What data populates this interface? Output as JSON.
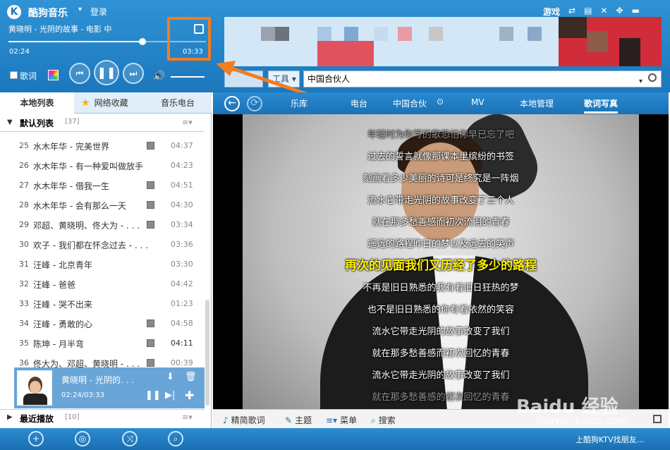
{
  "app": {
    "logo": "K",
    "title": "酷狗音乐",
    "login": "登录"
  },
  "player": {
    "track": "黄晓明 - 光阴的故事 - 电影 中",
    "elapsed": "02:24",
    "total": "03:33",
    "progress": 0.68,
    "lyric_toggle": "歌词",
    "prev": "⏮",
    "play": "❚❚",
    "next": "⏭",
    "volume_icon": "🔊"
  },
  "window": {
    "game": "游戏",
    "controls": [
      "⇄",
      "▤",
      "✕",
      "✥",
      "▬"
    ]
  },
  "toolbar": {
    "tools_label": "工具",
    "search_value": "中国合伙人",
    "caret": "▾"
  },
  "sidebar": {
    "tabs": {
      "local": "本地列表",
      "favorites": "网络收藏",
      "radio": "音乐电台"
    },
    "default_list": {
      "name": "默认列表",
      "count": "[37]",
      "menu": "≡▾"
    },
    "songs": [
      {
        "num": "25",
        "title": "水木年华 - 完美世界",
        "mv": true,
        "dur": "04:37",
        "dark": false
      },
      {
        "num": "26",
        "title": "水木年华 - 有一种爱叫做放手",
        "mv": false,
        "dur": "04:23",
        "dark": false
      },
      {
        "num": "27",
        "title": "水木年华 - 借我一生",
        "mv": true,
        "dur": "04:51",
        "dark": false
      },
      {
        "num": "28",
        "title": "水木年华 - 会有那么一天",
        "mv": true,
        "dur": "04:30",
        "dark": false
      },
      {
        "num": "29",
        "title": "邓超、黄晓明、佟大为 - . . .",
        "mv": true,
        "dur": "03:34",
        "dark": false
      },
      {
        "num": "30",
        "title": "欢子 - 我们都在怀念过去 - . . .",
        "mv": false,
        "dur": "03:36",
        "dark": false
      },
      {
        "num": "31",
        "title": "汪峰 - 北京青年",
        "mv": false,
        "dur": "03:30",
        "dark": false
      },
      {
        "num": "32",
        "title": "汪峰 - 爸爸",
        "mv": false,
        "dur": "04:42",
        "dark": false
      },
      {
        "num": "33",
        "title": "汪峰 - 哭不出来",
        "mv": false,
        "dur": "01:23",
        "dark": false
      },
      {
        "num": "34",
        "title": "汪峰 - 勇敢的心",
        "mv": true,
        "dur": "04:58",
        "dark": false
      },
      {
        "num": "35",
        "title": "陈坤 - 月半弯",
        "mv": true,
        "dur": "04:11",
        "dark": true
      },
      {
        "num": "36",
        "title": "佟大为、邓超、黄晓明 - . . .",
        "mv": true,
        "dur": "00:39",
        "dark": false
      }
    ],
    "now_playing": {
      "title": "黄晓明 - 光阴的. . .",
      "time": "02:24/03:33"
    },
    "recent": {
      "name": "最近播放",
      "count": "[10]",
      "menu": "≡▾"
    }
  },
  "nav": {
    "back": "←",
    "refresh": "⟳",
    "tabs": [
      "乐库",
      "电台",
      "中国合伙",
      "MV",
      "本地管理",
      "歌词写真"
    ],
    "active": "歌词写真"
  },
  "lyrics": [
    {
      "text": "年轻时为你写的歌恐怕你早已忘了吧",
      "state": "faded"
    },
    {
      "text": "过去的誓言就像那课本里缤纷的书签",
      "state": "normal"
    },
    {
      "text": "刻画着多少美丽的诗可是终究是一阵烟",
      "state": "normal"
    },
    {
      "text": "流水它带走光阴的故事改变了三个人",
      "state": "normal"
    },
    {
      "text": "就在那多愁善感而初次流泪的青春",
      "state": "normal"
    },
    {
      "text": "遥远的路程昨日的梦以及远去的笑声",
      "state": "normal"
    },
    {
      "text": "再次的见面我们又历经了多少的路程",
      "state": "current"
    },
    {
      "text": "不再是旧日熟悉的我有着旧日狂热的梦",
      "state": "normal"
    },
    {
      "text": "也不是旧日熟悉的你有着依然的笑容",
      "state": "normal"
    },
    {
      "text": "流水它带走光阴的故事改变了我们",
      "state": "normal"
    },
    {
      "text": "就在那多愁善感而初次回忆的青春",
      "state": "normal"
    },
    {
      "text": "流水它带走光阴的故事改变了我们",
      "state": "normal"
    },
    {
      "text": "就在那多愁善感的初次回忆的青春",
      "state": "faded"
    }
  ],
  "lyric_toolbar": {
    "simple": "精简歌词",
    "theme": "主题",
    "menu": "菜单",
    "search": "搜索"
  },
  "bottom": {
    "ktv": "上酷狗KTV找朋友..."
  },
  "watermark": {
    "main": "Baidu 经验",
    "sub": "jingyan.baidu.com"
  },
  "colors": {
    "accent": "#1c77bc",
    "highlight": "#f57c1f",
    "current_lyric": "#fff200"
  }
}
